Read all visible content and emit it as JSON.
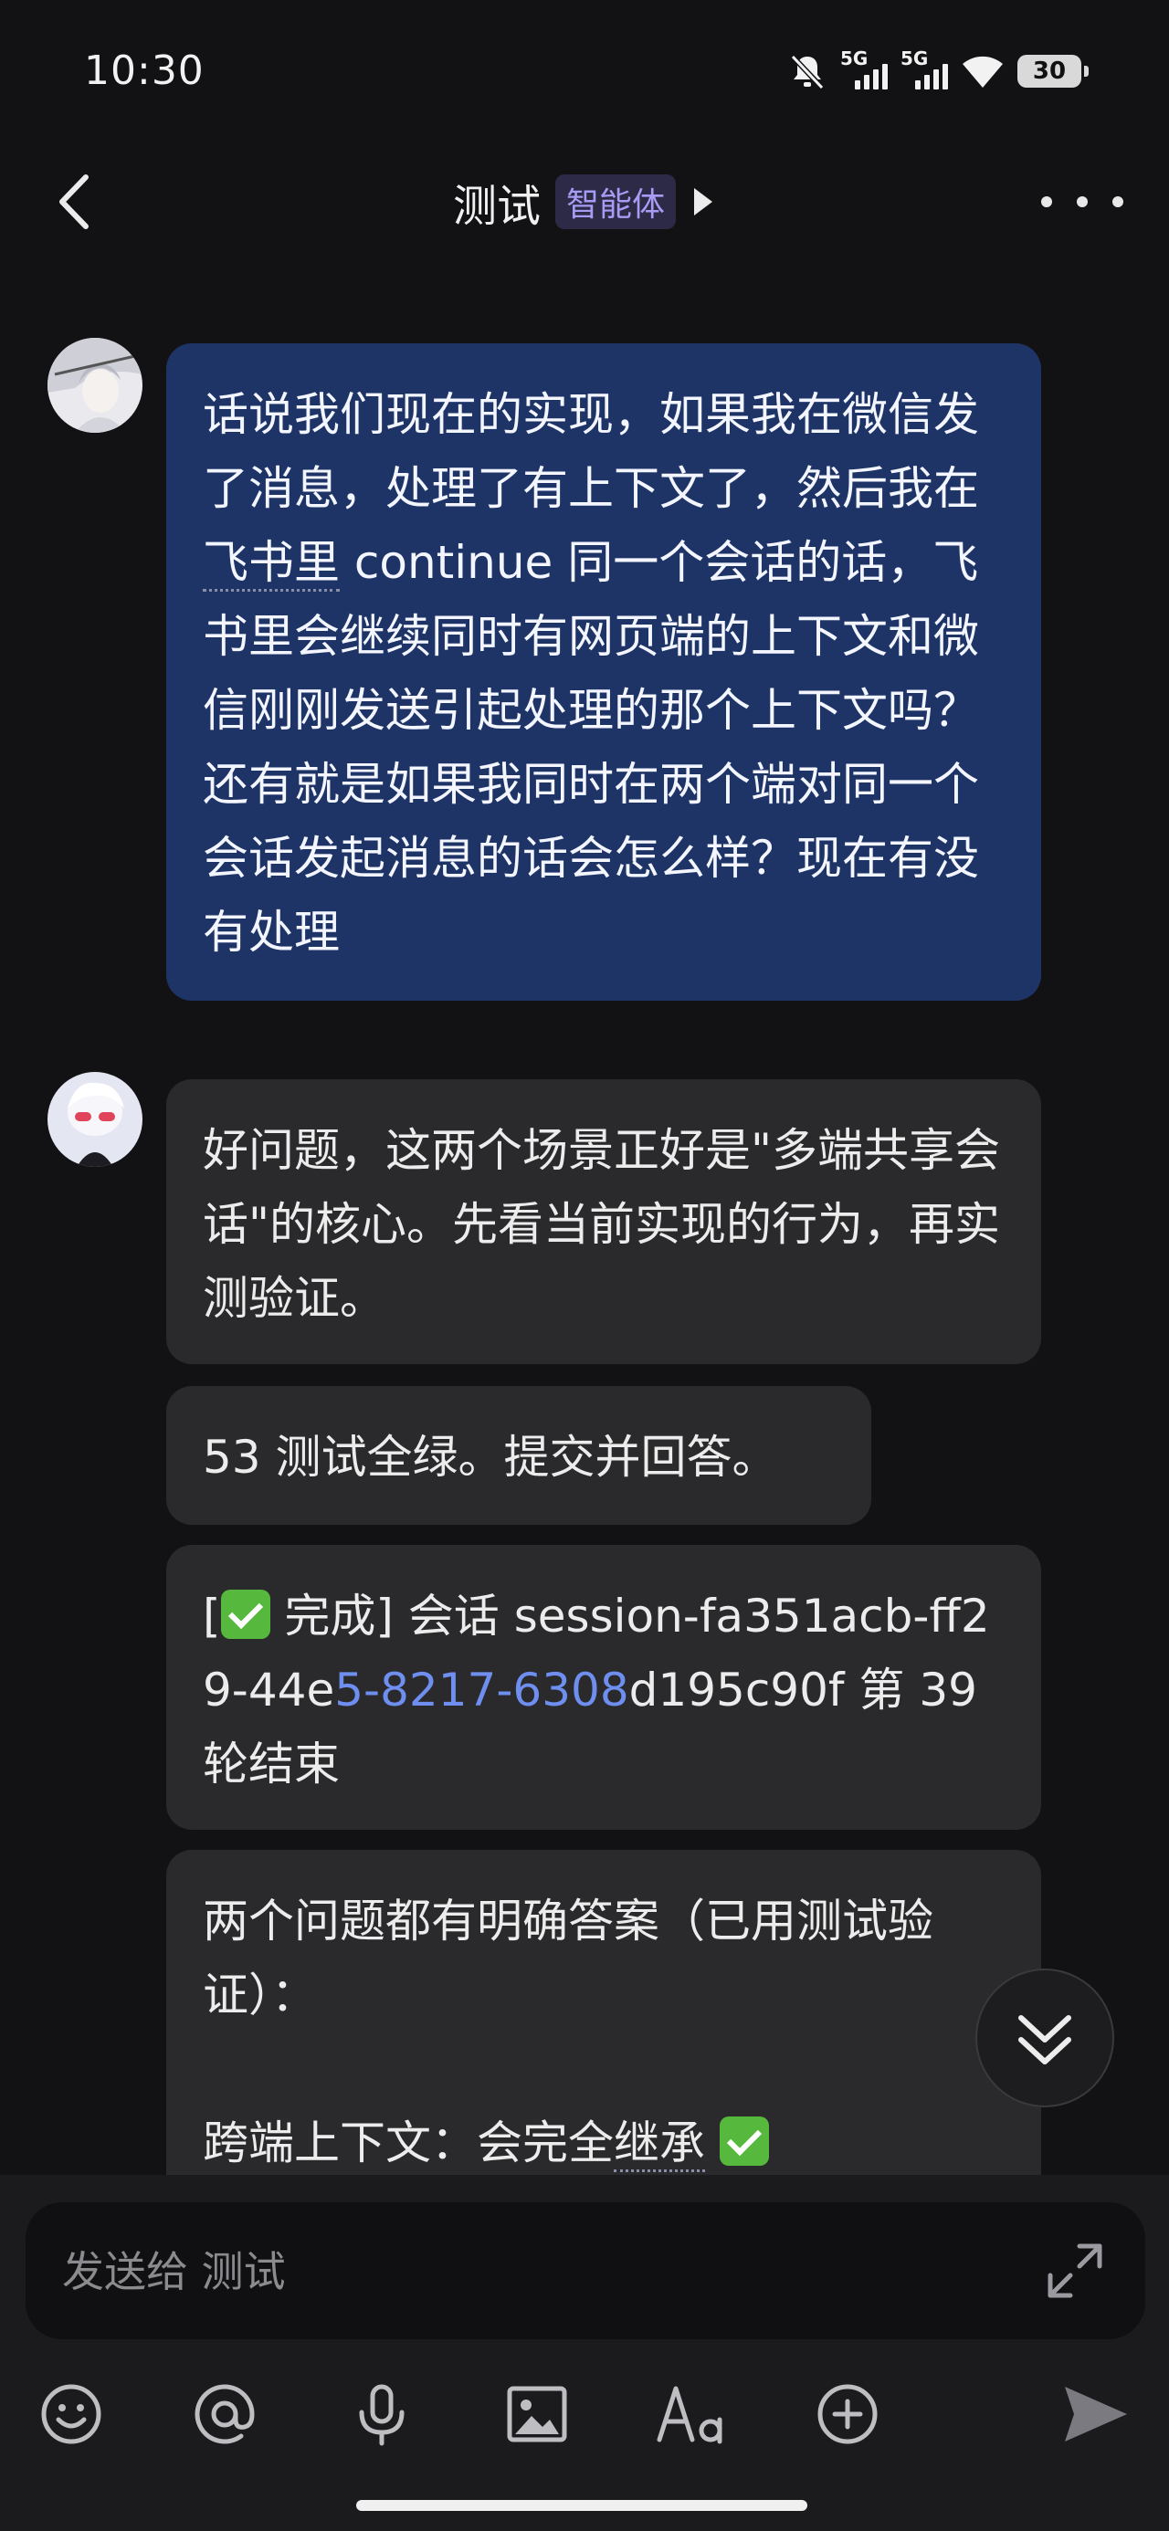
{
  "status_bar": {
    "time": "10:30",
    "net1": "5G",
    "net2": "5G",
    "battery": "30"
  },
  "header": {
    "title": "测试",
    "badge": "智能体"
  },
  "messages": {
    "user1": {
      "p1": "话说我们现在的实现，如果我在微信发了消息，处理了有上下文了，然后我在",
      "p2": "飞书里",
      "p3": " continue 同一个会话的话，飞书里会继续同时有网页端的上下文和微信刚刚发送引起处理的那个上下文吗？还有就是如果我同时在两个端对同一个会话发起消息的话会怎么样？现在有没有处理"
    },
    "bot1": "好问题，这两个场景正好是\"多端共享会话\"的核心。先看当前实现的行为，再实测验证。",
    "bot2": "53 测试全绿。提交并回答。",
    "bot3": {
      "pre": "[",
      "p1": " 完成] 会话 session-fa351acb-ff29-44e",
      "link": "5-8217-6308",
      "p2": "d195c90f 第 39 轮结束"
    },
    "bot4": {
      "line1": "两个问题都有明确答案（已用测试验证）：",
      "line2a": "跨端上下文：会完全",
      "line2b": "继承"
    }
  },
  "input": {
    "placeholder": "发送给 测试"
  },
  "toolbar": [
    "emoji-icon",
    "at-icon",
    "mic-icon",
    "image-icon",
    "font-icon",
    "plus-circle-icon",
    "send-icon"
  ]
}
